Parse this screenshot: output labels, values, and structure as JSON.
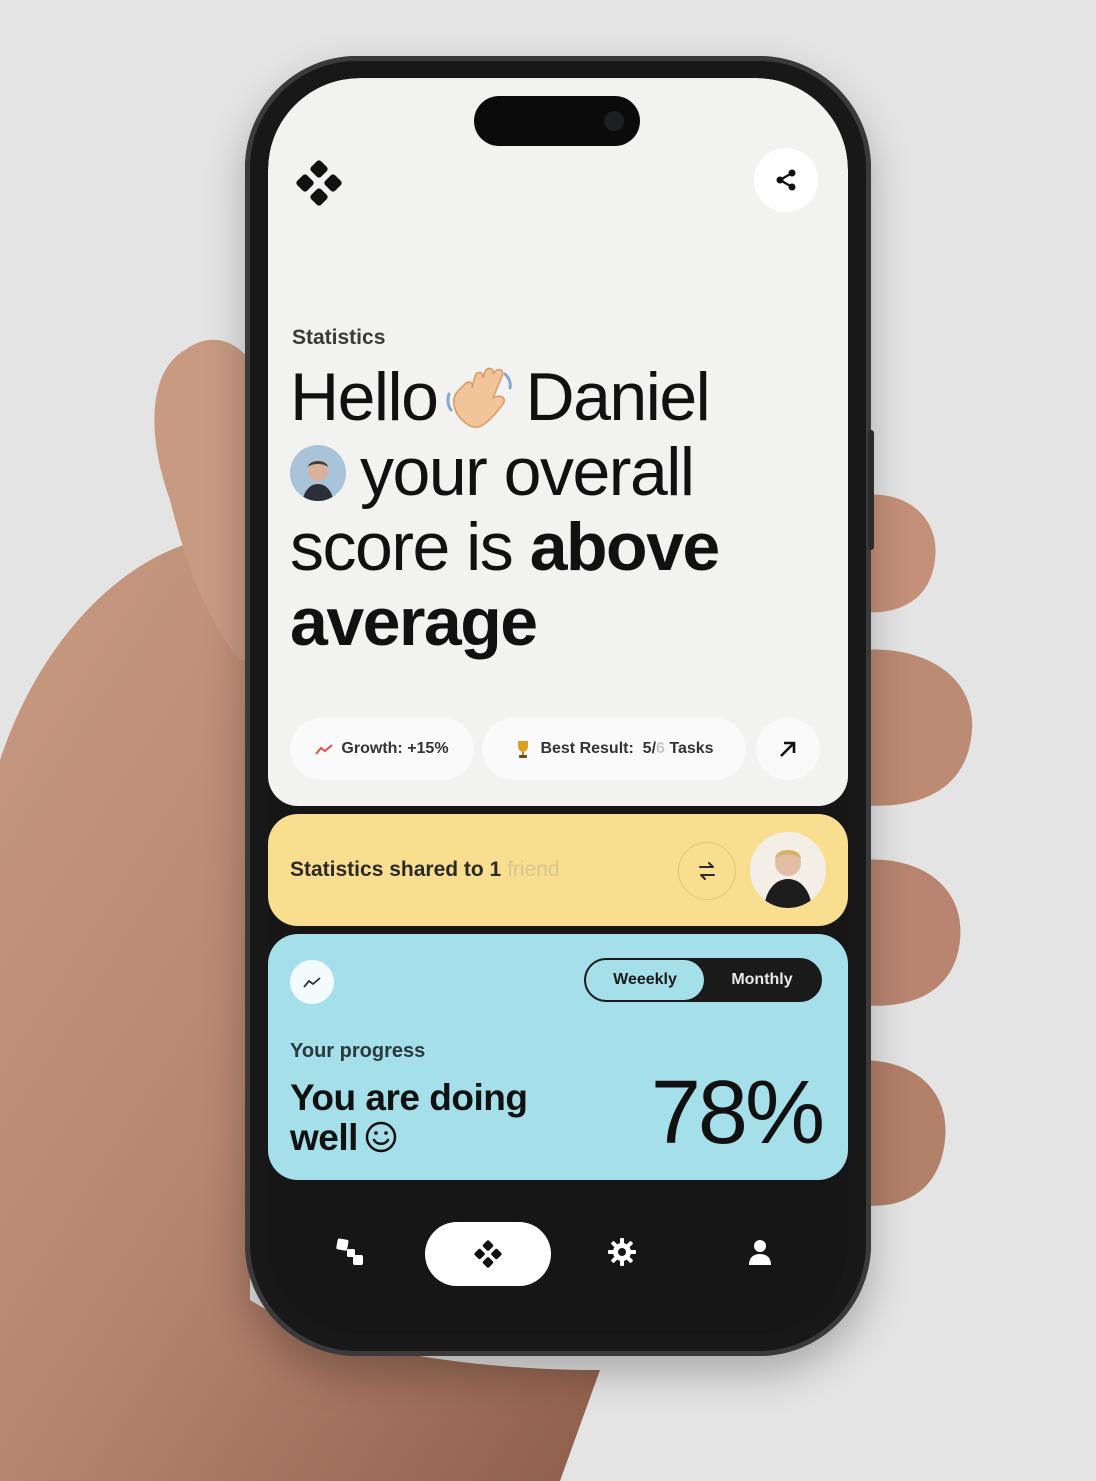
{
  "header": {
    "logo_icon": "four-diamond-logo-icon",
    "share_icon": "share-icon"
  },
  "statistics": {
    "label": "Statistics",
    "hello": "Hello",
    "name": "Daniel",
    "line2": "your overall",
    "line3_regular": "score is ",
    "line3_bold": "above",
    "line4_bold": "average"
  },
  "chips": {
    "growth": "Growth: +15%",
    "best_result_prefix": "Best Result:  5/",
    "best_result_muted": "6",
    "best_result_suffix": " Tasks"
  },
  "shared": {
    "text": "Statistics shared to 1 ",
    "muted": "friend"
  },
  "progress": {
    "toggle_weekly": "Weeekly",
    "toggle_monthly": "Monthly",
    "selected": "Weeekly",
    "label": "Your progress",
    "message_line1": "You are doing",
    "message_line2": "well",
    "percent": "78%",
    "percent_value": 78
  },
  "nav": {
    "items": [
      "steps-icon",
      "home-logo-icon",
      "gear-icon",
      "user-icon"
    ],
    "active": "home-logo-icon"
  },
  "colors": {
    "background_card": "#f2f2f1",
    "yellow_card": "#f8de8e",
    "blue_card": "#a5dfe9",
    "dark": "#161616",
    "growth_accent": "#e84a4a",
    "trophy": "#d9a021"
  }
}
